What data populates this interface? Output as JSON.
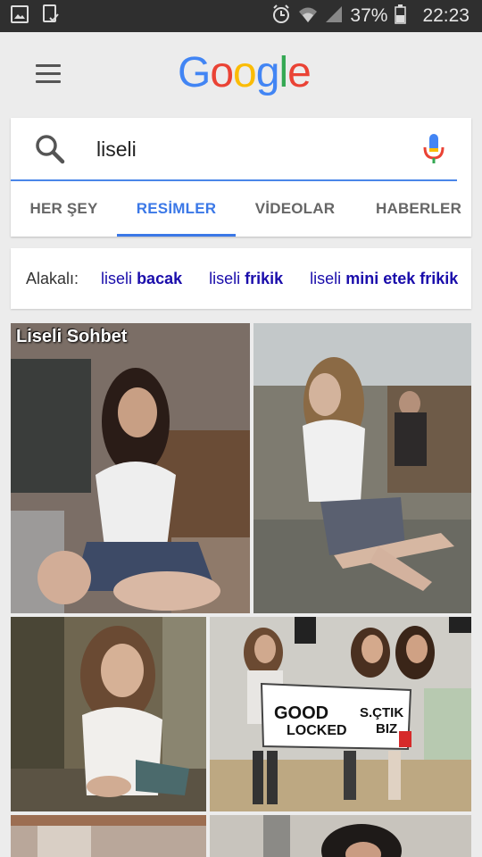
{
  "status_bar": {
    "battery": "37%",
    "time": "22:23"
  },
  "header": {
    "logo": [
      "G",
      "o",
      "o",
      "g",
      "l",
      "e"
    ],
    "logo_colors": [
      "#4285f4",
      "#ea4335",
      "#fbbc05",
      "#4285f4",
      "#34a853",
      "#ea4335"
    ]
  },
  "search": {
    "query": "liseli"
  },
  "tabs": [
    {
      "label": "HER ŞEY"
    },
    {
      "label": "RESİMLER",
      "active": true
    },
    {
      "label": "VİDEOLAR"
    },
    {
      "label": "HABERLER"
    }
  ],
  "related": {
    "label": "Alakalı:",
    "chips": [
      {
        "base": "liseli",
        "bold": "bacak"
      },
      {
        "base": "liseli",
        "bold": "frikik"
      },
      {
        "base": "liseli",
        "bold": "mini etek frikik"
      }
    ]
  },
  "images": [
    {
      "caption": "Liseli Sohbet"
    },
    {
      "caption": ""
    },
    {
      "caption": ""
    },
    {
      "caption": ""
    },
    {
      "caption": ""
    },
    {
      "caption": ""
    }
  ],
  "sign": {
    "line1": "GOOD",
    "line2": "LOCKED",
    "line3": "S.ÇTIK",
    "line4": "BIZ"
  },
  "colors": {
    "accent": "#3b78e7",
    "link": "#1a0dab",
    "status_bar": "#2f2f2f",
    "background": "#ececec"
  }
}
